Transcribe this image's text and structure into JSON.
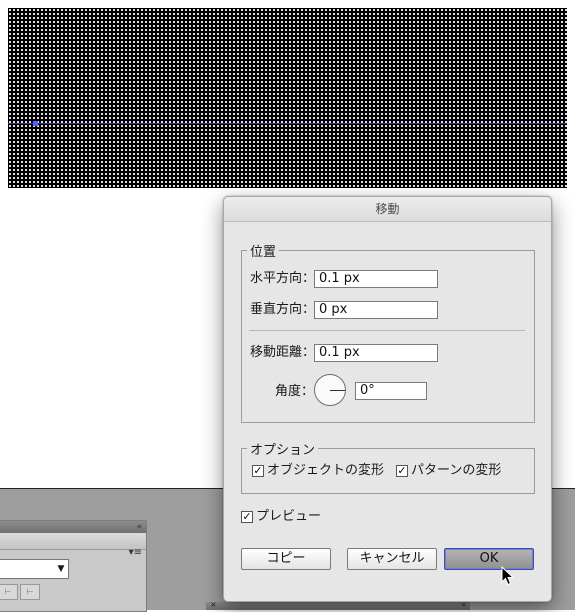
{
  "dialog": {
    "title": "移動",
    "position_group": {
      "legend": "位置",
      "horizontal_label": "水平方向：",
      "horizontal_value": "0.1 px",
      "vertical_label": "垂直方向：",
      "vertical_value": "0 px",
      "distance_label": "移動距離：",
      "distance_value": "0.1 px",
      "angle_label": "角度：",
      "angle_value": "0°"
    },
    "options_group": {
      "legend": "オプション",
      "transform_objects_label": "オブジェクトの変形",
      "transform_objects_checked": true,
      "transform_patterns_label": "パターンの変形",
      "transform_patterns_checked": true
    },
    "preview_label": "プレビュー",
    "preview_checked": true,
    "buttons": {
      "copy": "コピー",
      "cancel": "キャンセル",
      "ok": "OK"
    }
  },
  "icons": {
    "check_mark": "☑",
    "cursor": "arrow-pointer",
    "panel_collapse": "«",
    "panel_menu": "▾≡",
    "dropdown_arrow": "▼",
    "panel_close": "×"
  },
  "colors": {
    "ok_focus_ring": "#3a4fa8",
    "selection": "#4e63ff"
  }
}
